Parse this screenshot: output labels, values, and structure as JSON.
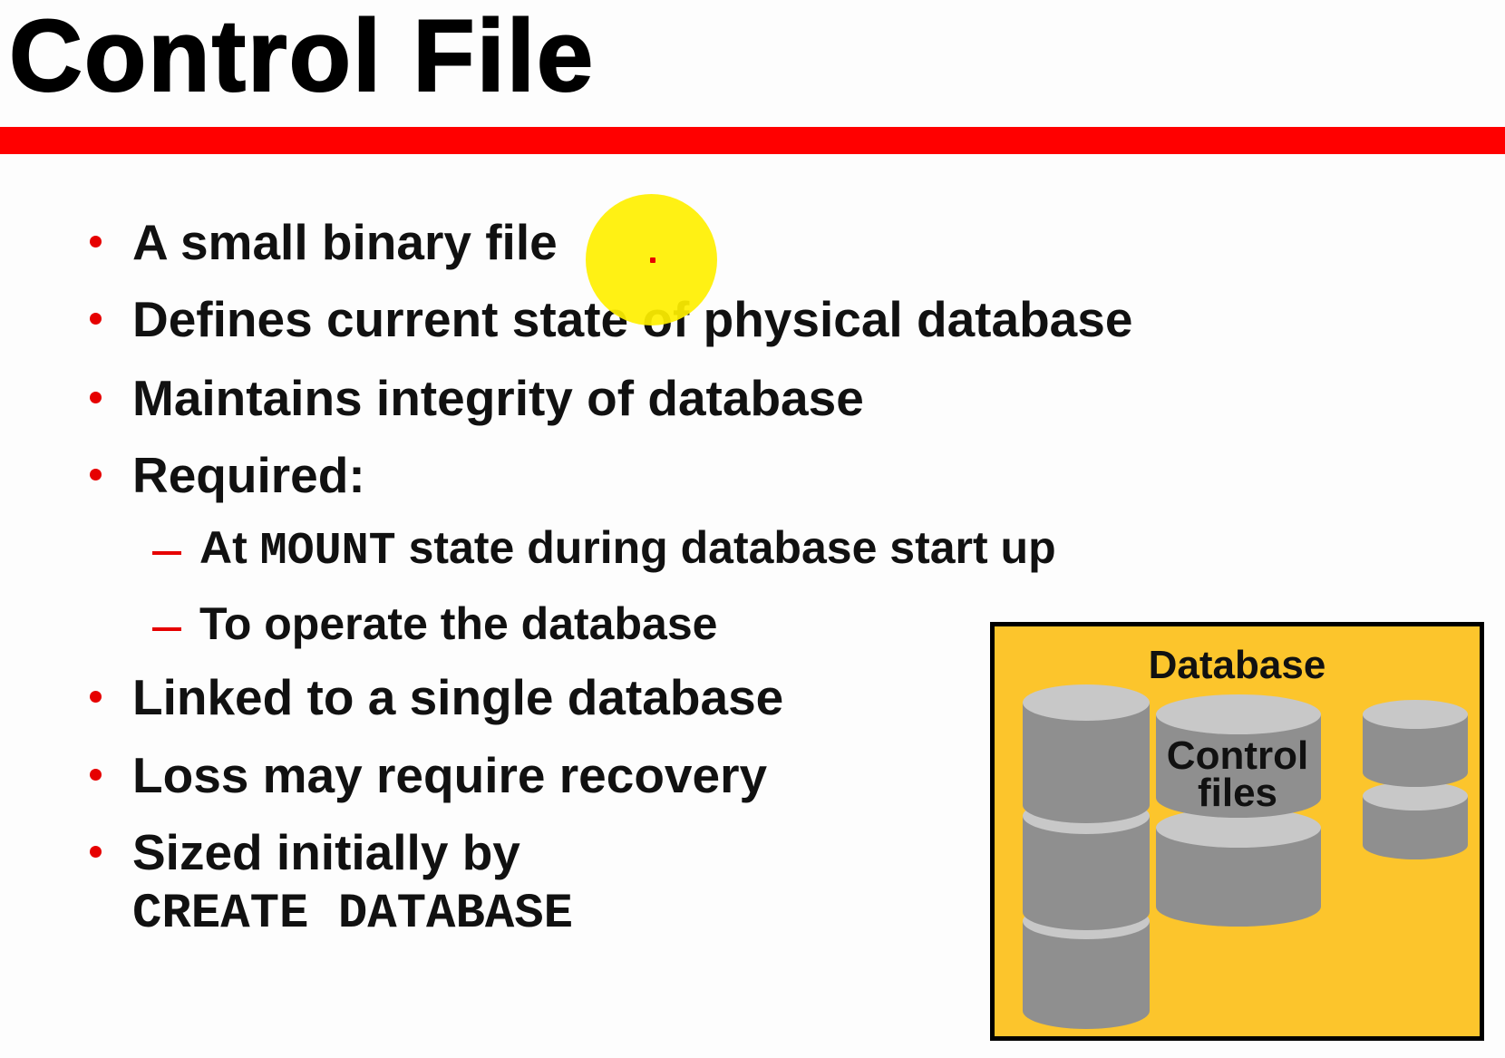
{
  "slide": {
    "title": "Control File",
    "bullets": [
      "A small binary file",
      "Defines current state of physical database",
      "Maintains integrity of database",
      "Required:"
    ],
    "sub_bullets": [
      {
        "prefix": "At ",
        "code": "MOUNT",
        "suffix": " state during database start up"
      },
      {
        "text": "To operate the database"
      }
    ],
    "bullets_after": [
      "Linked to a single database",
      "Loss may require recovery",
      "Sized initially by"
    ],
    "code_line": "CREATE DATABASE"
  },
  "diagram": {
    "box_label": "Database",
    "control_files_label_line1": "Control",
    "control_files_label_line2": "files",
    "colors": {
      "box_fill": "#fcc52c",
      "cylinder_fill": "#8f8f8f",
      "cylinder_top": "#c8c8c8",
      "accent_red": "#ff0000"
    }
  },
  "pointer": {
    "color": "#ffee00"
  }
}
